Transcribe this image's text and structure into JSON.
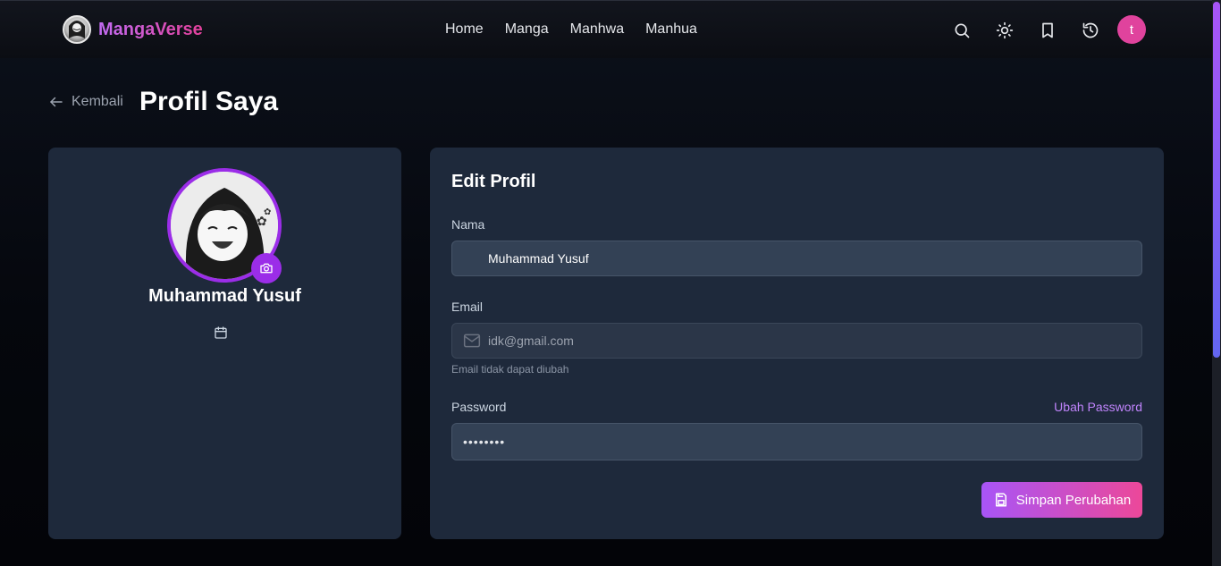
{
  "header": {
    "brand": "MangaVerse",
    "nav": [
      "Home",
      "Manga",
      "Manhwa",
      "Manhua"
    ],
    "icons": [
      "search-icon",
      "sun-icon",
      "bookmark-icon",
      "history-icon"
    ],
    "user_initial": "t"
  },
  "titlebar": {
    "back_label": "Kembali",
    "title": "Profil Saya"
  },
  "profile": {
    "name": "Muhammad Yusuf",
    "join_date": ""
  },
  "form": {
    "title": "Edit Profil",
    "name_label": "Nama",
    "name_value": "Muhammad Yusuf",
    "email_label": "Email",
    "email_value": "idk@gmail.com",
    "email_hint": "Email tidak dapat diubah",
    "password_label": "Password",
    "change_password": "Ubah Password",
    "password_value": "••••••••",
    "save_label": "Simpan Perubahan"
  },
  "colors": {
    "accent": "#a855f7",
    "accent2": "#ec4899",
    "card": "#1e293b",
    "avatar": "#e0439d"
  }
}
